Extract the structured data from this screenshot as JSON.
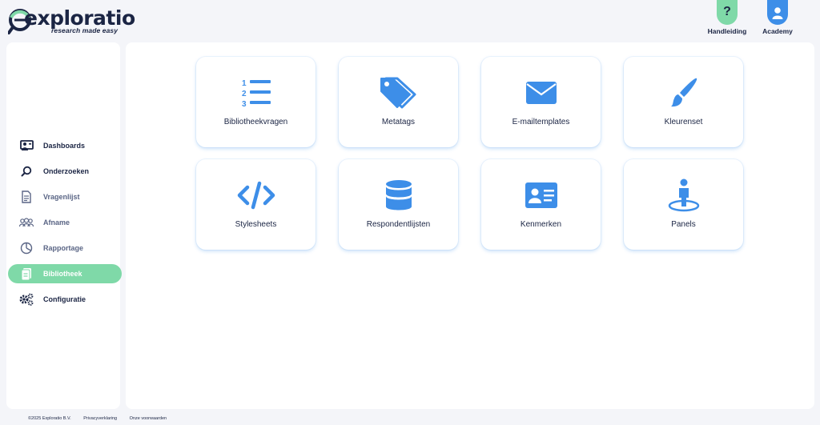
{
  "brand": {
    "name": "exploratio",
    "tagline": "research made easy"
  },
  "header": {
    "help_label": "Handleiding",
    "help_symbol": "?",
    "academy_label": "Academy"
  },
  "sidebar": {
    "items": [
      {
        "label": "Dashboards",
        "icon": "dashboard-icon"
      },
      {
        "label": "Onderzoeken",
        "icon": "search-icon"
      },
      {
        "label": "Vragenlijst",
        "icon": "document-icon"
      },
      {
        "label": "Afname",
        "icon": "users-icon"
      },
      {
        "label": "Rapportage",
        "icon": "pie-chart-icon"
      },
      {
        "label": "Bibliotheek",
        "icon": "library-icon",
        "active": true
      },
      {
        "label": "Configuratie",
        "icon": "gears-icon"
      }
    ]
  },
  "tiles": [
    {
      "label": "Bibliotheekvragen",
      "icon": "numbered-list-icon"
    },
    {
      "label": "Metatags",
      "icon": "tags-icon"
    },
    {
      "label": "E-mailtemplates",
      "icon": "envelope-icon"
    },
    {
      "label": "Kleurenset",
      "icon": "paint-brush-icon"
    },
    {
      "label": "Stylesheets",
      "icon": "code-icon"
    },
    {
      "label": "Respondentlijsten",
      "icon": "database-icon"
    },
    {
      "label": "Kenmerken",
      "icon": "id-card-icon"
    },
    {
      "label": "Panels",
      "icon": "person-ring-icon"
    }
  ],
  "footer": {
    "copyright": "©2025 Exploratio B.V.",
    "privacy": "Privacyverklaring",
    "terms": "Onze voorwaarden"
  },
  "colors": {
    "accent": "#3d8ee8",
    "active": "#7fd9a8",
    "text": "#1b2544"
  }
}
